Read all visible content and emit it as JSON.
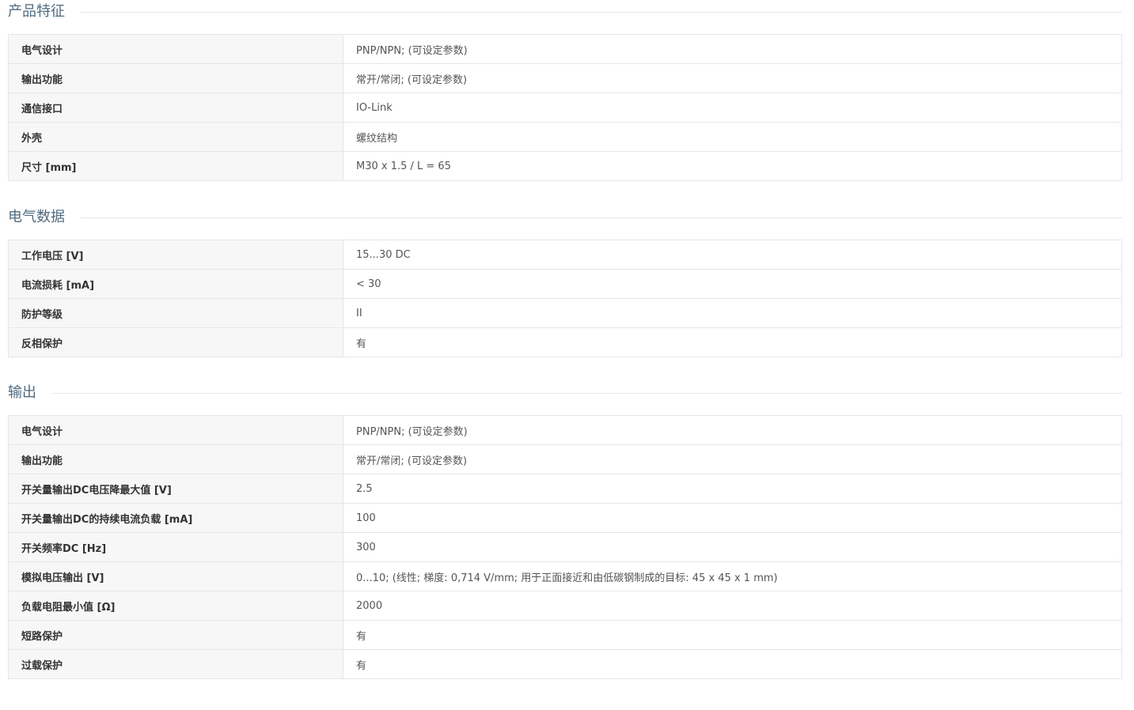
{
  "sections": [
    {
      "title": "产品特征",
      "rows": [
        {
          "label": "电气设计",
          "value": "PNP/NPN; (可设定参数)"
        },
        {
          "label": "输出功能",
          "value": "常开/常闭; (可设定参数)"
        },
        {
          "label": "通信接口",
          "value": "IO-Link"
        },
        {
          "label": "外壳",
          "value": "螺纹结构"
        },
        {
          "label": "尺寸 [mm]",
          "value": "M30 x 1.5 / L = 65"
        }
      ]
    },
    {
      "title": "电气数据",
      "rows": [
        {
          "label": "工作电压 [V]",
          "value": "15...30 DC"
        },
        {
          "label": "电流损耗 [mA]",
          "value": "< 30"
        },
        {
          "label": "防护等级",
          "value": "II"
        },
        {
          "label": "反相保护",
          "value": "有"
        }
      ]
    },
    {
      "title": "输出",
      "rows": [
        {
          "label": "电气设计",
          "value": "PNP/NPN; (可设定参数)"
        },
        {
          "label": "输出功能",
          "value": "常开/常闭; (可设定参数)"
        },
        {
          "label": "开关量输出DC电压降最大值 [V]",
          "value": "2.5"
        },
        {
          "label": "开关量输出DC的持续电流负载 [mA]",
          "value": "100"
        },
        {
          "label": "开关频率DC [Hz]",
          "value": "300"
        },
        {
          "label": "模拟电压输出 [V]",
          "value": "0...10; (线性; 梯度: 0,714 V/mm; 用于正面接近和由低碳钢制成的目标: 45 x 45 x 1 mm)"
        },
        {
          "label": "负载电阻最小值 [Ω]",
          "value": "2000"
        },
        {
          "label": "短路保护",
          "value": "有"
        },
        {
          "label": "过载保护",
          "value": "有"
        }
      ]
    }
  ]
}
